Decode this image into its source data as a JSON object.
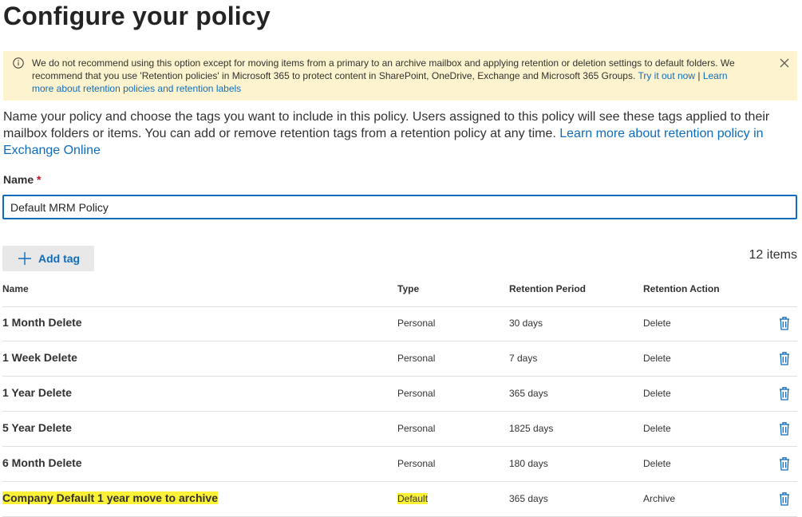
{
  "page": {
    "title": "Configure your policy"
  },
  "banner": {
    "icon": "info-icon",
    "text": "We do not recommend using this option except for moving items from a primary to an archive mailbox and applying retention or deletion settings to default folders. We recommend that you use 'Retention policies' in Microsoft 365 to protect content in SharePoint, OneDrive, Exchange and Microsoft 365 Groups. ",
    "link1": "Try it out now",
    "separator": " | ",
    "link2": "Learn more about retention policies and retention labels",
    "close_icon": "close-icon",
    "background": "#fdf4cf"
  },
  "intro": {
    "text": "Name your policy and choose the tags you want to include in this policy. Users assigned to this policy will see these tags applied to their mailbox folders or items. You can add or remove retention tags from a retention policy at any time. ",
    "link": "Learn more about retention policy in Exchange Online"
  },
  "form": {
    "name_label": "Name",
    "required_mark": "*",
    "name_value": "Default MRM Policy"
  },
  "toolbar": {
    "add_tag_label": "Add tag",
    "add_icon": "plus-icon",
    "item_count": "12 items"
  },
  "table": {
    "headers": {
      "name": "Name",
      "type": "Type",
      "period": "Retention Period",
      "action": "Retention Action"
    },
    "rows": [
      {
        "name": "1 Month Delete",
        "type": "Personal",
        "period": "30 days",
        "action": "Delete",
        "highlighted": false
      },
      {
        "name": "1 Week Delete",
        "type": "Personal",
        "period": "7 days",
        "action": "Delete",
        "highlighted": false
      },
      {
        "name": "1 Year Delete",
        "type": "Personal",
        "period": "365 days",
        "action": "Delete",
        "highlighted": false
      },
      {
        "name": "5 Year Delete",
        "type": "Personal",
        "period": "1825 days",
        "action": "Delete",
        "highlighted": false
      },
      {
        "name": "6 Month Delete",
        "type": "Personal",
        "period": "180 days",
        "action": "Delete",
        "highlighted": false
      },
      {
        "name": "Company Default 1 year move to archive",
        "type": "Default",
        "period": "365 days",
        "action": "Archive",
        "highlighted": true
      }
    ],
    "delete_icon": "trash-icon"
  },
  "colors": {
    "accent": "#0f6cbd",
    "highlight": "#fbf238",
    "required": "#c50f1f"
  }
}
